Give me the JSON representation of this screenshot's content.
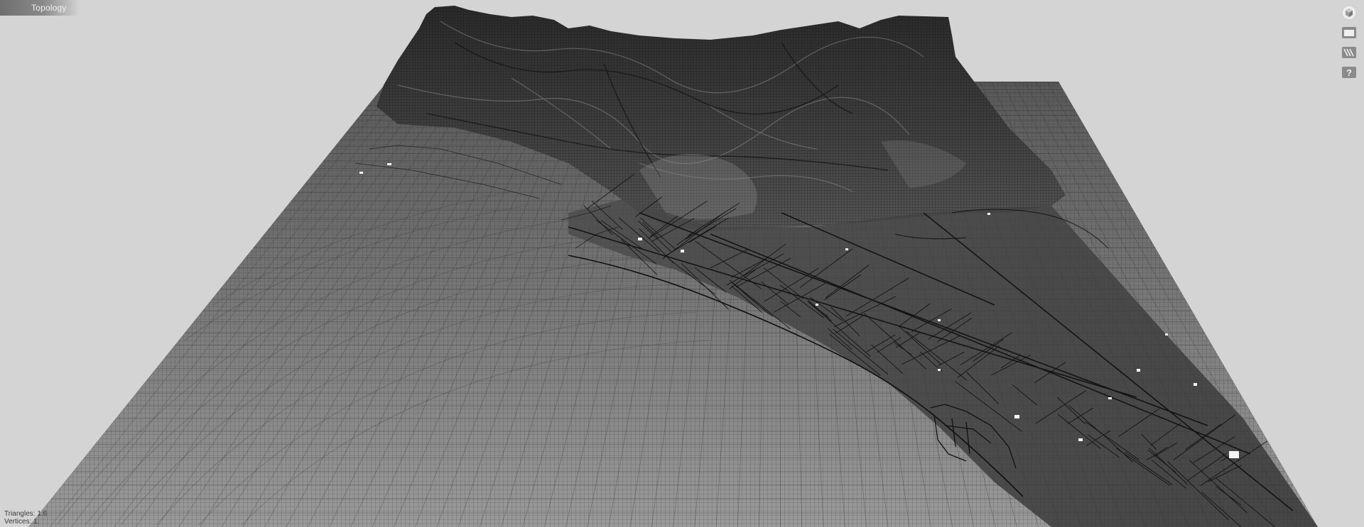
{
  "window": {
    "title": "Topology"
  },
  "toolbar": {
    "buttons": [
      {
        "name": "view-cube-icon"
      },
      {
        "name": "panel-icon"
      },
      {
        "name": "wireframe-icon"
      },
      {
        "name": "help-icon",
        "glyph": "?"
      }
    ]
  },
  "stats": {
    "triangles": "Triangles: 1.6",
    "vertices": "Vertices: 1."
  },
  "colors": {
    "background": "#d4d4d4",
    "mesh_dark": "#1a1a1a",
    "mesh_mid": "#6a6a6a",
    "mesh_light": "#9a9a9a",
    "ui_gray": "#8a8a8a"
  }
}
